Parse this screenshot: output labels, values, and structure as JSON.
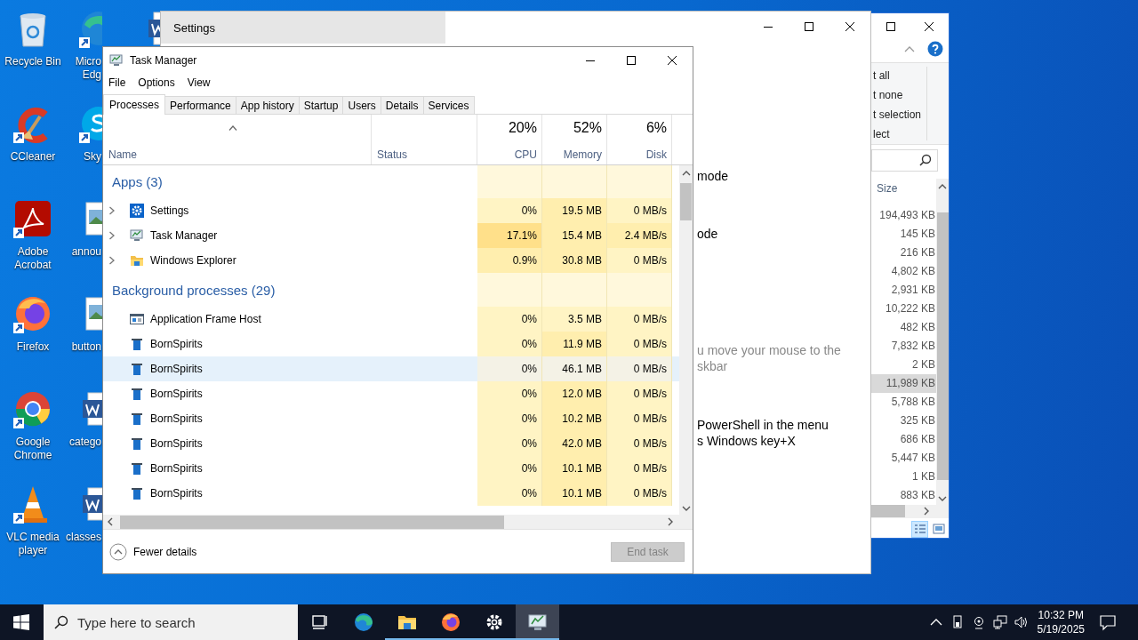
{
  "desktop_icons": [
    {
      "label_lines": [
        "Recycle Bin"
      ],
      "kind": "recycle-bin",
      "shortcut": false
    },
    {
      "label_lines": [
        "CCleaner"
      ],
      "kind": "ccleaner",
      "shortcut": true
    },
    {
      "label_lines": [
        "Adobe",
        "Acrobat"
      ],
      "kind": "acrobat",
      "shortcut": true
    },
    {
      "label_lines": [
        "Firefox"
      ],
      "kind": "firefox",
      "shortcut": true
    },
    {
      "label_lines": [
        "Google",
        "Chrome"
      ],
      "kind": "chrome",
      "shortcut": true
    },
    {
      "label_lines": [
        "VLC media",
        "player"
      ],
      "kind": "vlc",
      "shortcut": true
    },
    {
      "label_lines": [
        "Micro",
        "Edg"
      ],
      "kind": "edge",
      "shortcut": true
    },
    {
      "label_lines": [
        "Sky"
      ],
      "kind": "skype",
      "shortcut": true
    },
    {
      "label_lines": [
        "annou"
      ],
      "kind": "image-file",
      "shortcut": false
    },
    {
      "label_lines": [
        "button"
      ],
      "kind": "image-file",
      "shortcut": false
    },
    {
      "label_lines": [
        "catego"
      ],
      "kind": "word-document",
      "shortcut": false
    },
    {
      "label_lines": [
        "classes"
      ],
      "kind": "word-document",
      "shortcut": false
    },
    {
      "kind": "word-document",
      "shortcut": false
    }
  ],
  "explorer_window": {
    "ribbon_items": [
      "t all",
      "t none",
      "t selection",
      "lect"
    ],
    "size_header": "Size",
    "sizes": [
      {
        "text": "194,493 KB",
        "selected": false
      },
      {
        "text": "145 KB",
        "selected": false
      },
      {
        "text": "216 KB",
        "selected": false
      },
      {
        "text": "4,802 KB",
        "selected": false
      },
      {
        "text": "2,931 KB",
        "selected": false
      },
      {
        "text": "10,222 KB",
        "selected": false
      },
      {
        "text": "482 KB",
        "selected": false
      },
      {
        "text": "7,832 KB",
        "selected": false
      },
      {
        "text": "2 KB",
        "selected": false
      },
      {
        "text": "11,989 KB",
        "selected": true
      },
      {
        "text": "5,788 KB",
        "selected": false
      },
      {
        "text": "325 KB",
        "selected": false
      },
      {
        "text": "686 KB",
        "selected": false
      },
      {
        "text": "5,447 KB",
        "selected": false
      },
      {
        "text": "1 KB",
        "selected": false
      },
      {
        "text": "883 KB",
        "selected": false
      }
    ],
    "views": [
      {
        "kind": "details",
        "selected": true
      },
      {
        "kind": "large-icons",
        "selected": false
      }
    ]
  },
  "settings_window": {
    "title": "Settings",
    "paragraphs": [
      {
        "lines": [
          "mode"
        ],
        "muted": false
      },
      {
        "lines": [
          "ode"
        ],
        "muted": false
      },
      {
        "lines": [
          "u move your mouse to the",
          "skbar"
        ],
        "muted": true
      },
      {
        "lines": [
          "PowerShell in the menu",
          "s Windows key+X"
        ],
        "muted": false
      }
    ]
  },
  "task_manager": {
    "title": "Task Manager",
    "menu": [
      "File",
      "Options",
      "View"
    ],
    "tabs": [
      {
        "label": "Processes",
        "selected": true
      },
      {
        "label": "Performance",
        "selected": false
      },
      {
        "label": "App history",
        "selected": false
      },
      {
        "label": "Startup",
        "selected": false
      },
      {
        "label": "Users",
        "selected": false
      },
      {
        "label": "Details",
        "selected": false
      },
      {
        "label": "Services",
        "selected": false
      }
    ],
    "columns": {
      "name": "Name",
      "status": "Status",
      "cpu": {
        "percent": "20%",
        "label": "CPU"
      },
      "memory": {
        "percent": "52%",
        "label": "Memory"
      },
      "disk": {
        "percent": "6%",
        "label": "Disk"
      }
    },
    "groups": [
      {
        "title": "Apps (3)",
        "rows": [
          {
            "name": "Settings",
            "kind": "settings",
            "expandable": true,
            "selected": false,
            "cpu": {
              "text": "0%",
              "color": "#fff4c4"
            },
            "memory": {
              "text": "19.5 MB",
              "color": "#ffeeae"
            },
            "disk": {
              "text": "0 MB/s",
              "color": "#fff4c4"
            }
          },
          {
            "name": "Task Manager",
            "kind": "task-manager",
            "expandable": true,
            "selected": false,
            "cpu": {
              "text": "17.1%",
              "color": "#ffe08a"
            },
            "memory": {
              "text": "15.4 MB",
              "color": "#ffeeae"
            },
            "disk": {
              "text": "2.4 MB/s",
              "color": "#ffeeae"
            }
          },
          {
            "name": "Windows Explorer",
            "kind": "folder",
            "expandable": true,
            "selected": false,
            "cpu": {
              "text": "0.9%",
              "color": "#ffeeae"
            },
            "memory": {
              "text": "30.8 MB",
              "color": "#ffeeae"
            },
            "disk": {
              "text": "0 MB/s",
              "color": "#fff4c4"
            }
          }
        ]
      },
      {
        "title": "Background processes (29)",
        "rows": [
          {
            "name": "Application Frame Host",
            "kind": "window",
            "expandable": false,
            "selected": false,
            "cpu": {
              "text": "0%",
              "color": "#fff4c4"
            },
            "memory": {
              "text": "3.5 MB",
              "color": "#fff4c4"
            },
            "disk": {
              "text": "0 MB/s",
              "color": "#fff4c4"
            }
          },
          {
            "name": "BornSpirits",
            "kind": "app",
            "expandable": false,
            "selected": false,
            "cpu": {
              "text": "0%",
              "color": "#fff4c4"
            },
            "memory": {
              "text": "11.9 MB",
              "color": "#ffeeae"
            },
            "disk": {
              "text": "0 MB/s",
              "color": "#fff4c4"
            }
          },
          {
            "name": "BornSpirits",
            "kind": "app",
            "expandable": false,
            "selected": true,
            "cpu": {
              "text": "0%",
              "color": "#f4f2e6"
            },
            "memory": {
              "text": "46.1 MB",
              "color": "#f4f2e6"
            },
            "disk": {
              "text": "0 MB/s",
              "color": "#f4f2e6"
            }
          },
          {
            "name": "BornSpirits",
            "kind": "app",
            "expandable": false,
            "selected": false,
            "cpu": {
              "text": "0%",
              "color": "#fff4c4"
            },
            "memory": {
              "text": "12.0 MB",
              "color": "#ffeeae"
            },
            "disk": {
              "text": "0 MB/s",
              "color": "#fff4c4"
            }
          },
          {
            "name": "BornSpirits",
            "kind": "app",
            "expandable": false,
            "selected": false,
            "cpu": {
              "text": "0%",
              "color": "#fff4c4"
            },
            "memory": {
              "text": "10.2 MB",
              "color": "#ffeeae"
            },
            "disk": {
              "text": "0 MB/s",
              "color": "#fff4c4"
            }
          },
          {
            "name": "BornSpirits",
            "kind": "app",
            "expandable": false,
            "selected": false,
            "cpu": {
              "text": "0%",
              "color": "#fff4c4"
            },
            "memory": {
              "text": "42.0 MB",
              "color": "#ffeeae"
            },
            "disk": {
              "text": "0 MB/s",
              "color": "#fff4c4"
            }
          },
          {
            "name": "BornSpirits",
            "kind": "app",
            "expandable": false,
            "selected": false,
            "cpu": {
              "text": "0%",
              "color": "#fff4c4"
            },
            "memory": {
              "text": "10.1 MB",
              "color": "#ffeeae"
            },
            "disk": {
              "text": "0 MB/s",
              "color": "#fff4c4"
            }
          },
          {
            "name": "BornSpirits",
            "kind": "app",
            "expandable": false,
            "selected": false,
            "cpu": {
              "text": "0%",
              "color": "#fff4c4"
            },
            "memory": {
              "text": "10.1 MB",
              "color": "#ffeeae"
            },
            "disk": {
              "text": "0 MB/s",
              "color": "#fff4c4"
            }
          }
        ]
      }
    ],
    "details_toggle": "Fewer details",
    "end_task": {
      "label": "End task",
      "disabled": true
    }
  },
  "taskbar": {
    "search_placeholder": "Type here to search",
    "apps": [
      {
        "kind": "task-view",
        "running": false,
        "active": false
      },
      {
        "kind": "edge",
        "running": false,
        "active": false
      },
      {
        "kind": "folder",
        "running": true,
        "active": false
      },
      {
        "kind": "firefox",
        "running": true,
        "active": false
      },
      {
        "kind": "settings",
        "running": true,
        "active": false
      },
      {
        "kind": "task-manager",
        "running": true,
        "active": true
      }
    ],
    "time": "10:32 PM",
    "date": "5/19/2025"
  }
}
